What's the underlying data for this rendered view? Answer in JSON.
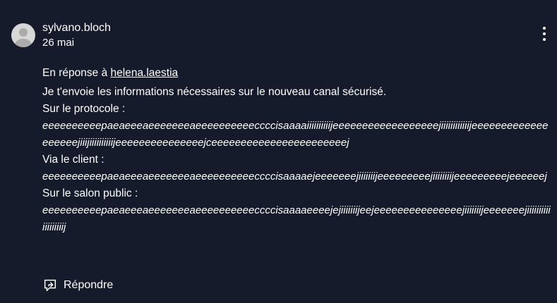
{
  "post": {
    "author": "sylvano.bloch",
    "date": "26 mai",
    "reply_prefix": "En réponse à ",
    "reply_user": "helena.laestia",
    "intro": "Je t'envoie les informations nécessaires sur le nouveau canal sécurisé.",
    "protocol_label": "Sur le protocole :",
    "protocol_value": "eeeeeeeeeepaeaeeeaeeeeeeeaeeeeeeeeeeccccisaaaaiiiiiiiiiijeeeeeeeeeeeeeeeeeejiiiiiiiiiiiijeeeeeeeeeeeeeeeeeeejiiijiiiiiiiiiijeeeeeeeeeeeeeeejceeeeeeeeeeeeeeeeeeeeeeej",
    "client_label": "Via le client :",
    "client_value": "eeeeeeeeeepaeaeeeaeeeeeeeaeeeeeeeeeeccccisaaaaejeeeeeeejiiiiiiijeeeeeeeeejiiiiiiiijeeeeeeeeejeeeeeej",
    "salon_label": "Sur le salon public :",
    "salon_value": "eeeeeeeeeepaeaeeeaeeeeeeeaeeeeeeeeeeccccisaaaaeeeejejiiiiiiijeejeeeeeeeeeeeeeeejiiiiiiijeeeeeeejiiiiiiiiiiiiiiiiiiij"
  },
  "actions": {
    "reply_label": "Répondre"
  },
  "icons": {
    "avatar": "default-user-avatar",
    "menu": "vertical-ellipsis-icon",
    "reply": "reply-speech-bubble-icon"
  },
  "colors": {
    "background": "#151b2b",
    "text": "#ffffff",
    "avatar_bg": "#d7d7d7",
    "avatar_fg": "#ababab"
  }
}
